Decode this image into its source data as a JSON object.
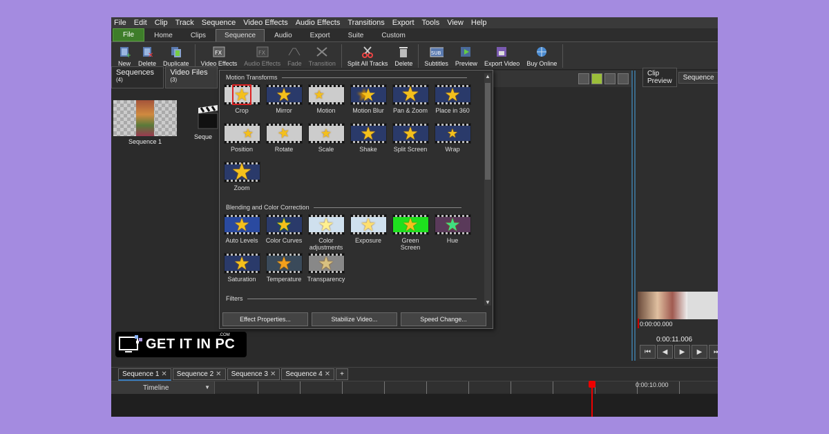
{
  "menu": [
    "File",
    "Edit",
    "Clip",
    "Track",
    "Sequence",
    "Video Effects",
    "Audio Effects",
    "Transitions",
    "Export",
    "Tools",
    "View",
    "Help"
  ],
  "ribbon_tabs": [
    "File",
    "Home",
    "Clips",
    "Sequence",
    "Audio",
    "Export",
    "Suite",
    "Custom"
  ],
  "toolbar": {
    "new": "New",
    "delete": "Delete",
    "duplicate": "Duplicate",
    "video_effects": "Video Effects",
    "audio_effects": "Audio Effects",
    "fade": "Fade",
    "transition": "Transition",
    "split_all_tracks": "Split All Tracks",
    "delete2": "Delete",
    "subtitles": "Subtitles",
    "preview": "Preview",
    "export_video": "Export Video",
    "buy_online": "Buy Online"
  },
  "left_panel": {
    "tab_sequences": "Sequences",
    "tab_sequences_count": "(4)",
    "tab_video_files": "Video Files",
    "tab_video_files_count": "(3)",
    "items": [
      "Sequence 1",
      "Seque"
    ]
  },
  "effects_popup": {
    "section_motion": "Motion Transforms",
    "motion": [
      "Crop",
      "Mirror",
      "Motion",
      "Motion Blur",
      "Pan & Zoom",
      "Place in 360",
      "Position",
      "Rotate",
      "Scale",
      "Shake",
      "Split Screen",
      "Wrap",
      "Zoom"
    ],
    "section_blending": "Blending and Color Correction",
    "blending": [
      "Auto Levels",
      "Color Curves",
      "Color adjustments",
      "Exposure",
      "Green Screen",
      "Hue",
      "Saturation",
      "Temperature",
      "Transparency"
    ],
    "section_filters": "Filters",
    "buttons": {
      "effect_properties": "Effect Properties...",
      "stabilize": "Stabilize Video...",
      "speed": "Speed Change..."
    }
  },
  "preview": {
    "tab_clip_preview": "Clip Preview",
    "tab_sequence": "Sequence",
    "time_start": "0:00:00.000",
    "time_total": "0:00:11.006"
  },
  "watermark": {
    "text": "GET IT IN PC",
    "com": ".COM"
  },
  "sequence_tabs": [
    "Sequence 1",
    "Sequence 2",
    "Sequence 3",
    "Sequence 4"
  ],
  "add_tab": "+",
  "timeline": {
    "label": "Timeline",
    "ruler_time": "0:00:10.000"
  },
  "colors": {
    "background": "#a48be0",
    "file_tab": "#3e7d2a",
    "playhead": "#ee0000",
    "star": "#f4c01c"
  }
}
